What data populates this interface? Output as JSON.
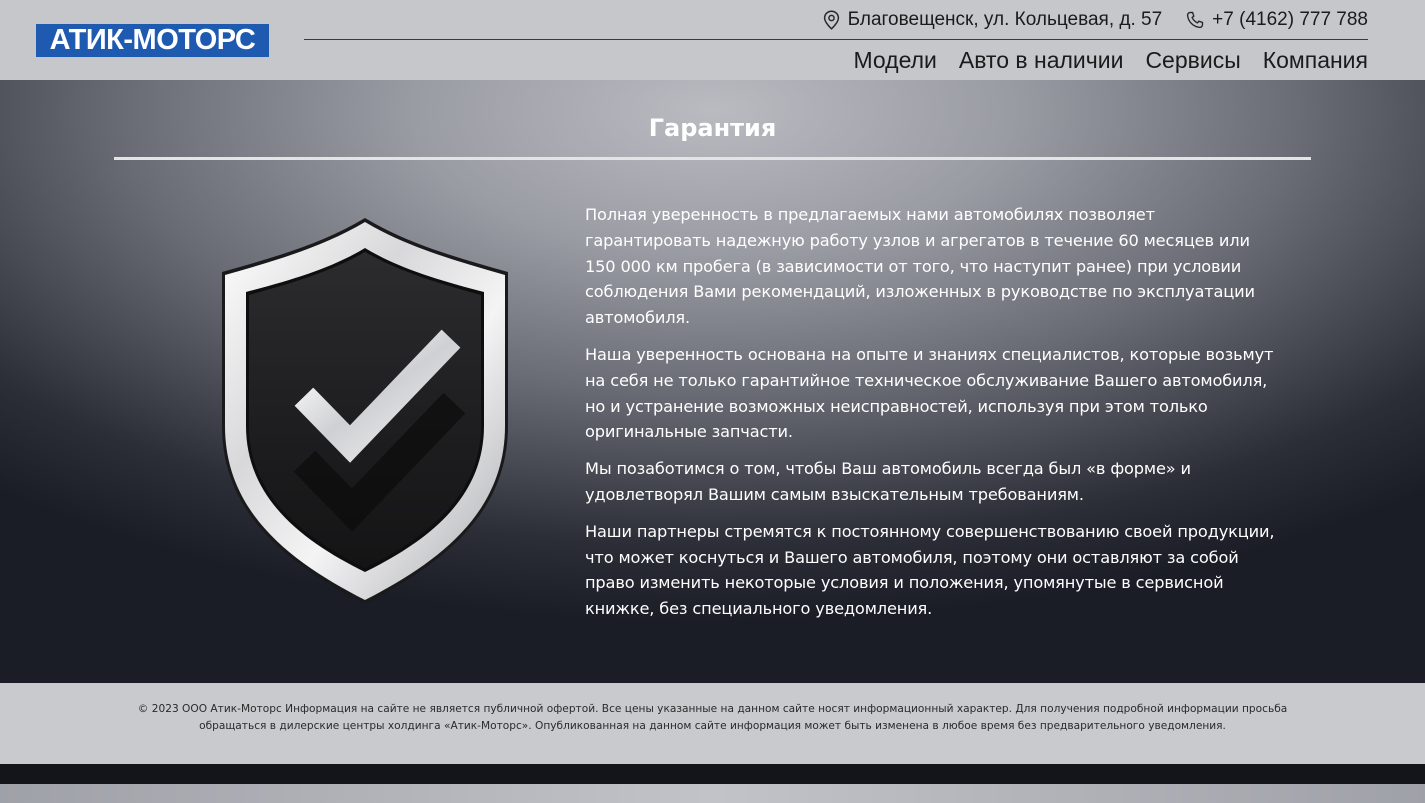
{
  "header": {
    "logo_text": "АТИК-МОТОРС",
    "address": "Благовещенск, ул. Кольцевая, д. 57",
    "phone": "+7 (4162) 777 788",
    "address_icon": "location-pin-icon",
    "phone_icon": "phone-icon",
    "brand_color": "#1e5bb0",
    "nav": [
      {
        "label": "Модели"
      },
      {
        "label": "Авто в наличии"
      },
      {
        "label": "Сервисы"
      },
      {
        "label": "Компания"
      }
    ]
  },
  "main": {
    "title": "Гарантия",
    "image_icon": "shield-check-icon",
    "paragraphs": [
      "Полная уверенность в предлагаемых нами автомобилях позволяет гарантировать надежную работу узлов и агрегатов в течение 60 месяцев или 150 000 км пробега (в зависимости от того, что наступит ранее) при условии соблюдения Вами рекомендаций, изложенных в руководстве по эксплуатации автомобиля.",
      "Наша уверенность основана на опыте и знаниях специалистов, которые возьмут на себя не только гарантийное техническое обслуживание Вашего автомобиля, но и устранение возможных неисправностей, используя при этом только оригинальные запчасти.",
      "Мы позаботимся о том, чтобы Ваш автомобиль всегда был «в форме» и удовлетворял Вашим самым взыскательным требованиям.",
      "Наши партнеры стремятся к постоянному совершенствованию своей продукции, что может коснуться и Вашего автомобиля, поэтому они оставляют за собой право изменить некоторые условия и положения, упомянутые в сервисной книжке, без специального уведомления."
    ]
  },
  "footer": {
    "text": "© 2023 ООО Атик-Моторс Информация на сайте не является публичной офертой. Все цены указанные на данном сайте носят информационный характер. Для получения подробной информации просьба обращаться в дилерские центры холдинга «Атик-Моторс». Опубликованная на данном сайте информация может быть изменена в любое время без предварительного уведомления."
  }
}
